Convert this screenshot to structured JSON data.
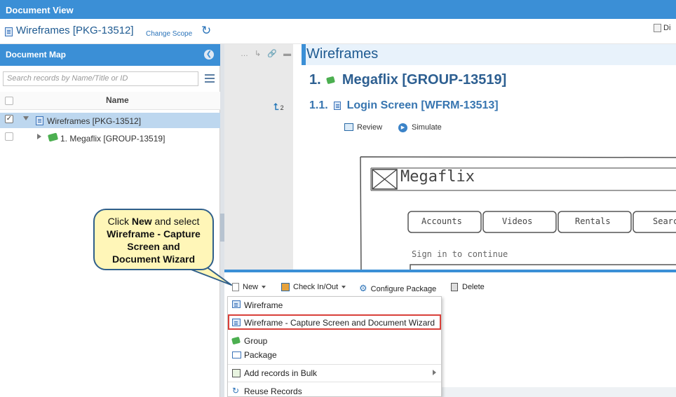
{
  "app_title": "Document View",
  "header": {
    "title": "Wireframes [PKG-13512]",
    "change_scope": "Change Scope",
    "right_label": "Di"
  },
  "document_map": {
    "title": "Document Map",
    "search_placeholder": "Search records by Name/Title or ID",
    "column_name": "Name",
    "rows": [
      {
        "label": "Wireframes [PKG-13512]",
        "checked": true,
        "selected": true
      },
      {
        "label": "1. Megaflix [GROUP-13519]",
        "checked": false,
        "selected": false
      }
    ]
  },
  "gutter": {
    "icons_text": "… ↳ 🔗 ▬",
    "count": "2"
  },
  "document": {
    "section_title": "Wireframes",
    "heading1_num": "1.",
    "heading1_text": "Megaflix [GROUP-13519]",
    "heading2_num": "1.1.",
    "heading2_text": "Login Screen [WFRM-13513]",
    "review": "Review",
    "simulate": "Simulate",
    "wireframe": {
      "logo": "Megaflix",
      "tabs": [
        "Accounts",
        "Videos",
        "Rentals",
        "Searc"
      ],
      "signin": "Sign in to continue"
    }
  },
  "toolbar": {
    "new": "New",
    "check": "Check In/Out",
    "configure": "Configure Package",
    "delete": "Delete"
  },
  "dropdown": {
    "items": [
      "Wireframe",
      "Wireframe - Capture Screen and Document Wizard",
      "Group",
      "Package",
      "Add records in Bulk",
      "Reuse Records"
    ]
  },
  "callout": {
    "line1_pre": "Click",
    "line1_bold": "New",
    "line1_post": "and select",
    "line2": "Wireframe - Capture",
    "line3": "Screen and",
    "line4": "Document Wizard"
  },
  "colors": {
    "primary": "#3b8fd6",
    "heading": "#2d5f91",
    "highlight_border": "#d9403a",
    "callout_bg": "#fff6b8"
  }
}
